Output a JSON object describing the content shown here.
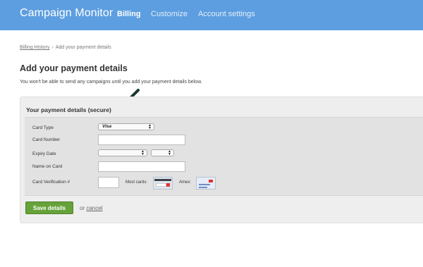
{
  "header": {
    "brand": "Campaign Monitor",
    "nav": [
      {
        "label": "Billing"
      },
      {
        "label": "Customize"
      },
      {
        "label": "Account settings"
      }
    ]
  },
  "breadcrumb": {
    "link": "Billing History",
    "separator": "›",
    "current": "Add your payment details"
  },
  "page": {
    "title": "Add your payment details",
    "description": "You won't be able to send any campaigns until you add your payment details below."
  },
  "form": {
    "title": "Your payment details (secure)",
    "card_type": {
      "label": "Card Type",
      "value": "Visa"
    },
    "card_number": {
      "label": "Card Number",
      "value": ""
    },
    "expiry": {
      "label": "Expiry Date",
      "month": "",
      "year": ""
    },
    "name_on_card": {
      "label": "Name on Card",
      "value": ""
    },
    "cvv": {
      "label": "Card Verification #",
      "value": "",
      "most_cards_label": "Most cards:",
      "amex_label": "Amex:"
    }
  },
  "actions": {
    "save_label": "Save details",
    "or_text": "or",
    "cancel_label": "cancel"
  },
  "icons": {
    "annotation": "arrow-down-left-icon",
    "card_back": "credit-card-back-icon",
    "amex_front": "amex-card-front-icon"
  },
  "colors": {
    "header_bg": "#5d9ee0",
    "save_button": "#66a23a",
    "panel_bg": "#eeeeee",
    "arrow": "#17392a"
  }
}
